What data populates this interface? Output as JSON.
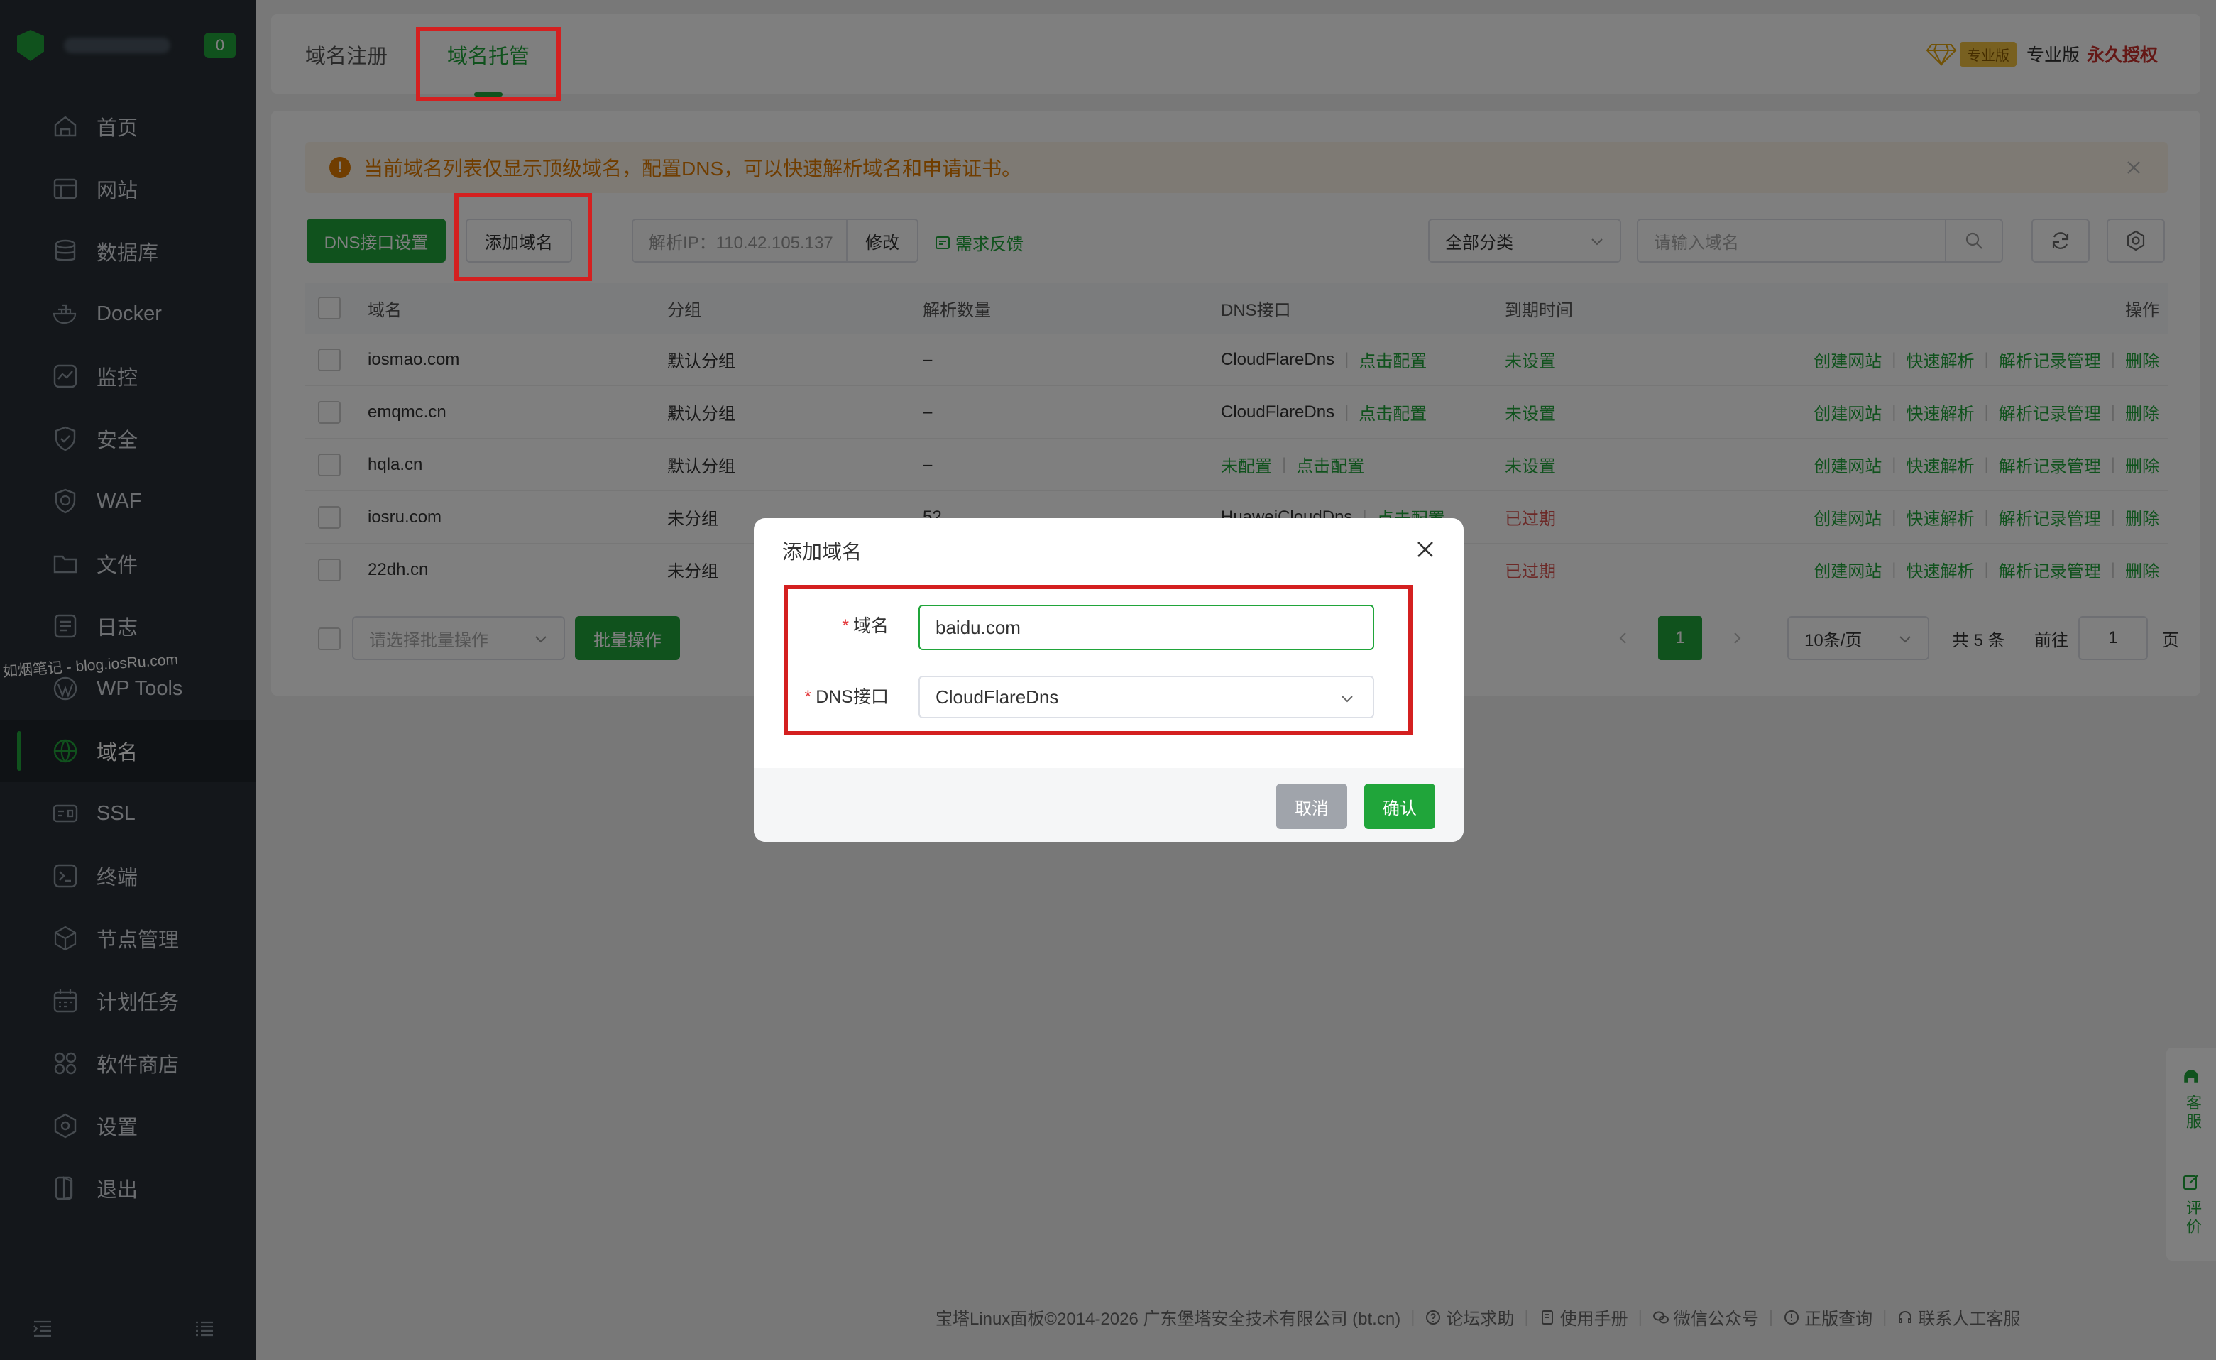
{
  "sidebar": {
    "host_count": "0",
    "items": [
      {
        "label": "首页",
        "icon": "home-icon"
      },
      {
        "label": "网站",
        "icon": "website-icon"
      },
      {
        "label": "数据库",
        "icon": "database-icon"
      },
      {
        "label": "Docker",
        "icon": "docker-icon"
      },
      {
        "label": "监控",
        "icon": "monitor-icon"
      },
      {
        "label": "安全",
        "icon": "shield-icon"
      },
      {
        "label": "WAF",
        "icon": "waf-icon"
      },
      {
        "label": "文件",
        "icon": "folder-icon"
      },
      {
        "label": "日志",
        "icon": "log-icon"
      },
      {
        "label": "WP Tools",
        "icon": "wordpress-icon"
      },
      {
        "label": "域名",
        "icon": "globe-icon"
      },
      {
        "label": "SSL",
        "icon": "ssl-icon"
      },
      {
        "label": "终端",
        "icon": "terminal-icon"
      },
      {
        "label": "节点管理",
        "icon": "cube-icon"
      },
      {
        "label": "计划任务",
        "icon": "calendar-icon"
      },
      {
        "label": "软件商店",
        "icon": "apps-icon"
      },
      {
        "label": "设置",
        "icon": "settings-icon"
      },
      {
        "label": "退出",
        "icon": "logout-icon"
      }
    ],
    "watermark": "如烟笔记 - blog.iosRu.com"
  },
  "header": {
    "tabs": [
      "域名注册",
      "域名托管"
    ],
    "pro_badge": "专业版",
    "pro_label": "专业版",
    "license": "永久授权"
  },
  "alert": "当前域名列表仅显示顶级域名，配置DNS，可以快速解析域名和申请证书。",
  "toolbar": {
    "dns_settings": "DNS接口设置",
    "add_domain": "添加域名",
    "resolve_ip": "解析IP：110.42.105.137",
    "edit": "修改",
    "feedback": "需求反馈",
    "category": "全部分类",
    "search_placeholder": "请输入域名"
  },
  "table": {
    "headers": [
      "域名",
      "分组",
      "解析数量",
      "DNS接口",
      "到期时间",
      "操作"
    ],
    "rows": [
      {
        "domain": "iosmao.com",
        "group": "默认分组",
        "count": "–",
        "dns": "CloudFlareDns",
        "dns_action": "点击配置",
        "expire": "未设置"
      },
      {
        "domain": "emqmc.cn",
        "group": "默认分组",
        "count": "–",
        "dns": "CloudFlareDns",
        "dns_action": "点击配置",
        "expire": "未设置"
      },
      {
        "domain": "hqla.cn",
        "group": "默认分组",
        "count": "–",
        "dns": "未配置",
        "dns_action": "点击配置",
        "expire": "未设置"
      },
      {
        "domain": "iosru.com",
        "group": "未分组",
        "count": "52",
        "dns": "HuaweiCloudDns",
        "dns_action": "点击配置",
        "expire": "已过期"
      },
      {
        "domain": "22dh.cn",
        "group": "未分组",
        "count": "",
        "dns": "",
        "dns_action": "",
        "expire": "已过期"
      }
    ],
    "row_actions": [
      "创建网站",
      "快速解析",
      "解析记录管理",
      "删除"
    ]
  },
  "batch": {
    "placeholder": "请选择批量操作",
    "button": "批量操作"
  },
  "pagination": {
    "page": "1",
    "page_size": "10条/页",
    "total": "共 5 条",
    "goto": "前往",
    "goto_value": "1",
    "page_suffix": "页"
  },
  "modal": {
    "title": "添加域名",
    "domain_label": "域名",
    "domain_value": "baidu.com",
    "dns_label": "DNS接口",
    "dns_value": "CloudFlareDns",
    "cancel": "取消",
    "confirm": "确认"
  },
  "float_tools": {
    "service": "客服",
    "review": "评价"
  },
  "footer": {
    "copyright": "宝塔Linux面板©2014-2026 广东堡塔安全技术有限公司 (bt.cn)",
    "links": [
      "论坛求助",
      "使用手册",
      "微信公众号",
      "正版查询",
      "联系人工客服"
    ]
  },
  "colors": {
    "brand": "#20a53a",
    "sidebar_bg": "#282f36",
    "warning": "#e07b00",
    "danger": "#d9534f",
    "highlight_box": "#d42020"
  }
}
